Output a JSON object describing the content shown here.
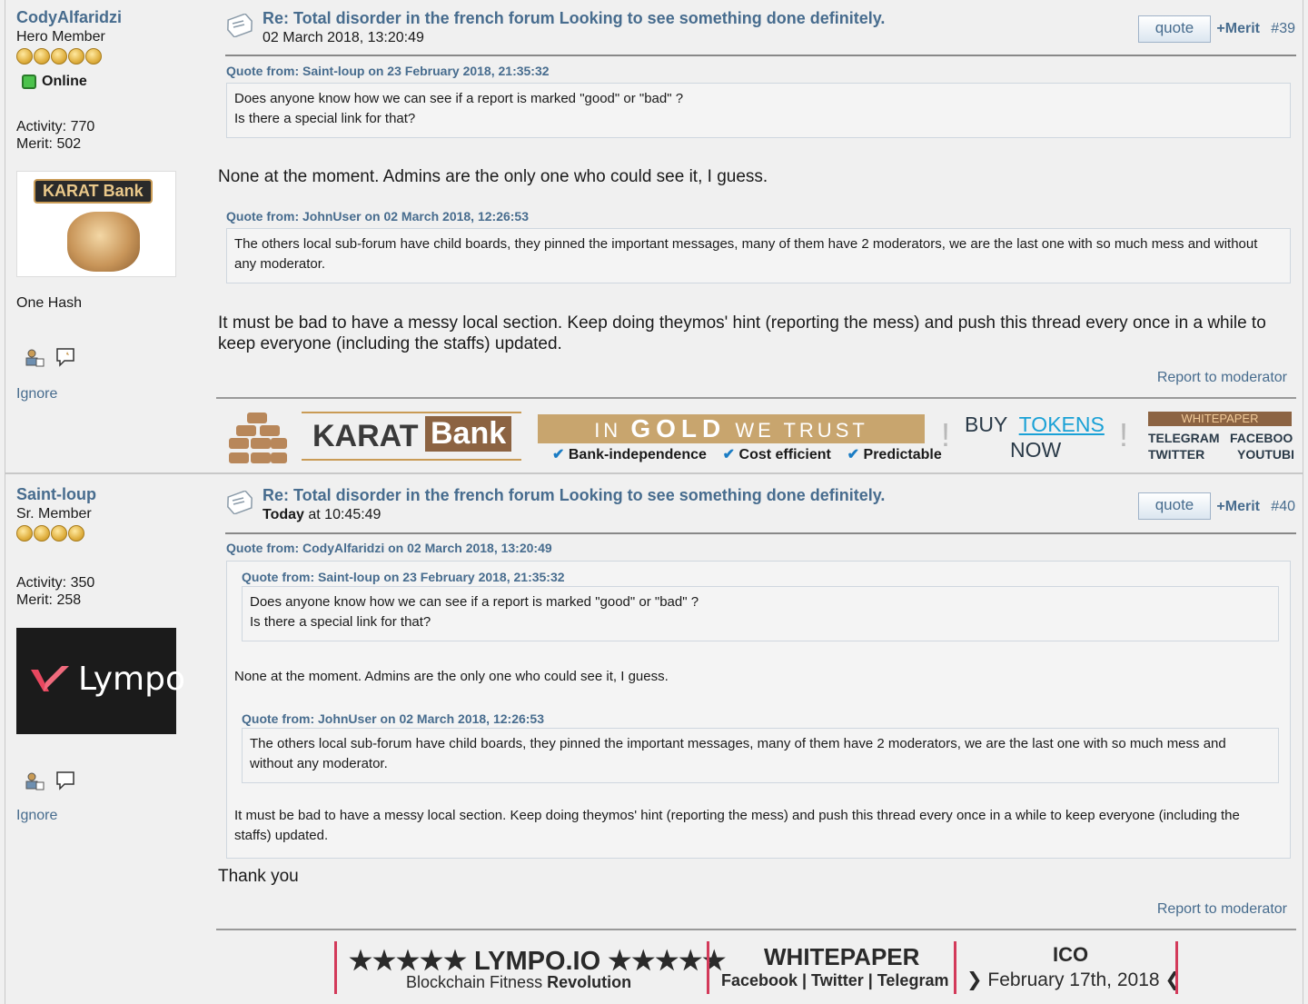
{
  "posts": [
    {
      "author": {
        "name": "CodyAlfaridzi",
        "rank": "Hero Member",
        "star_count": 5,
        "status": "Online",
        "activity": "Activity: 770",
        "merit": "Merit: 502",
        "avatar_text_1": "KARAT",
        "avatar_text_2": "Bank",
        "signature": "One Hash",
        "ignore": "Ignore"
      },
      "title": "Re: Total disorder in the french forum Looking to see something done definitely.",
      "date": "02 March 2018, 13:20:49",
      "quote_label": "quote",
      "merit_label": "+Merit",
      "number": "#39",
      "quotes": [
        {
          "header": "Quote from: Saint-loup on 23 February 2018, 21:35:32",
          "lines": [
            "Does anyone know how we can see if a report is marked \"good\" or \"bad\" ?",
            "Is there a special link for that?"
          ]
        },
        {
          "header": "Quote from: JohnUser on 02 March 2018, 12:26:53",
          "lines": [
            "The others local sub-forum have child boards, they pinned the important messages, many of them have 2 moderators, we are the last one with so much mess and without any moderator."
          ]
        }
      ],
      "paragraphs": [
        "None at the moment. Admins are the only one who could see it, I guess.",
        "It must be bad to have a messy local section. Keep doing theymos' hint (reporting the mess) and push this thread every once in a while to keep everyone (including the staffs) updated."
      ],
      "report": "Report to moderator",
      "sig_banner": {
        "karat": "KARAT",
        "bank": "Bank",
        "slogan_in": "IN",
        "slogan_gold": "GOLD",
        "slogan_we_trust": "WE TRUST",
        "check1": "Bank-independence",
        "check2": "Cost efficient",
        "check3": "Predictable",
        "buy": "BUY",
        "tokens": "TOKENS",
        "now": "NOW",
        "whitepaper": "WHITEPAPER",
        "telegram": "TELEGRAM",
        "facebook": "FACEBOOK",
        "twitter": "TWITTER",
        "youtube": "YOUTUBE"
      }
    },
    {
      "author": {
        "name": "Saint-loup",
        "rank": "Sr. Member",
        "star_count": 4,
        "activity": "Activity: 350",
        "merit": "Merit: 258",
        "avatar_text": "Lympo",
        "ignore": "Ignore"
      },
      "title": "Re: Total disorder in the french forum Looking to see something done definitely.",
      "date_bold": "Today",
      "date_rest": " at 10:45:49",
      "quote_label": "quote",
      "merit_label": "+Merit",
      "number": "#40",
      "outer_quote_header": "Quote from: CodyAlfaridzi on 02 March 2018, 13:20:49",
      "inner_quote1_header": "Quote from: Saint-loup on 23 February 2018, 21:35:32",
      "inner_quote1_lines": [
        "Does anyone know how we can see if a report is marked \"good\" or \"bad\" ?",
        "Is there a special link for that?"
      ],
      "outer_text1": "None at the moment. Admins are the only one who could see it, I guess.",
      "inner_quote2_header": "Quote from: JohnUser on 02 March 2018, 12:26:53",
      "inner_quote2_text": "The others local sub-forum have child boards, they pinned the important messages, many of them have 2 moderators, we are the last one with so much mess and without any moderator.",
      "outer_text2": "It must be bad to have a messy local section. Keep doing theymos' hint (reporting the mess) and push this thread every once in a while to keep everyone (including the staffs) updated.",
      "reply": "Thank you",
      "report": "Report to moderator",
      "sig_banner": {
        "title": "★★★★★ LYMPO.IO ★★★★★",
        "sub_plain": "Blockchain Fitness ",
        "sub_bold": "Revolution",
        "whitepaper": "WHITEPAPER",
        "links": "Facebook  |  Twitter  |  Telegram",
        "ico": "ICO",
        "ico_date": "❯ February 17th, 2018 ❮"
      }
    }
  ],
  "colors": {
    "link": "#476c8e",
    "background": "#f0f0f0",
    "accent_gold": "#c8a56e",
    "accent_red": "#d33a5a"
  },
  "icons": [
    "post-icon",
    "profile-icon",
    "message-icon",
    "online-icon",
    "star-coin-icon",
    "check-icon"
  ]
}
